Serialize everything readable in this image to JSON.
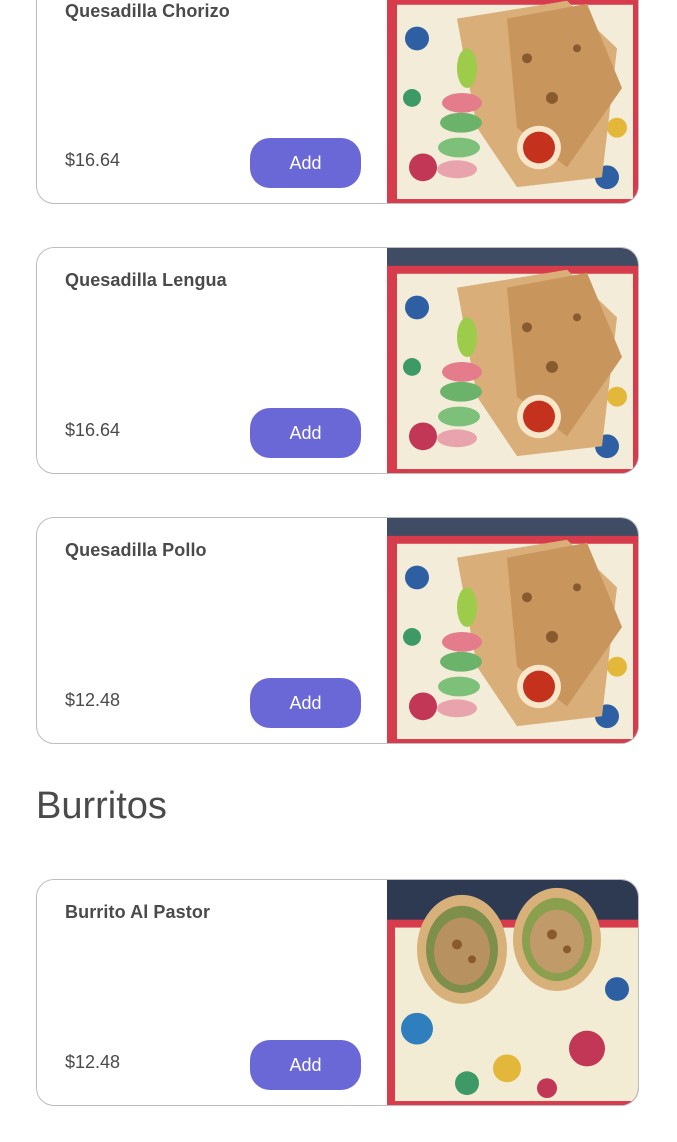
{
  "menu": {
    "items_top": [
      {
        "name": "Quesadilla Chorizo",
        "price": "$16.64",
        "add_label": "Add",
        "photo": "quesadilla-photo"
      },
      {
        "name": "Quesadilla Lengua",
        "price": "$16.64",
        "add_label": "Add",
        "photo": "quesadilla-photo"
      },
      {
        "name": "Quesadilla Pollo",
        "price": "$12.48",
        "add_label": "Add",
        "photo": "quesadilla-photo"
      }
    ],
    "section": {
      "heading": "Burritos"
    },
    "items_bottom": [
      {
        "name": "Burrito Al Pastor",
        "price": "$12.48",
        "add_label": "Add",
        "photo": "burrito-photo"
      }
    ]
  },
  "colors": {
    "accent": "#6a67d6",
    "text": "#4a4a4a",
    "border": "#bdbdbd"
  }
}
